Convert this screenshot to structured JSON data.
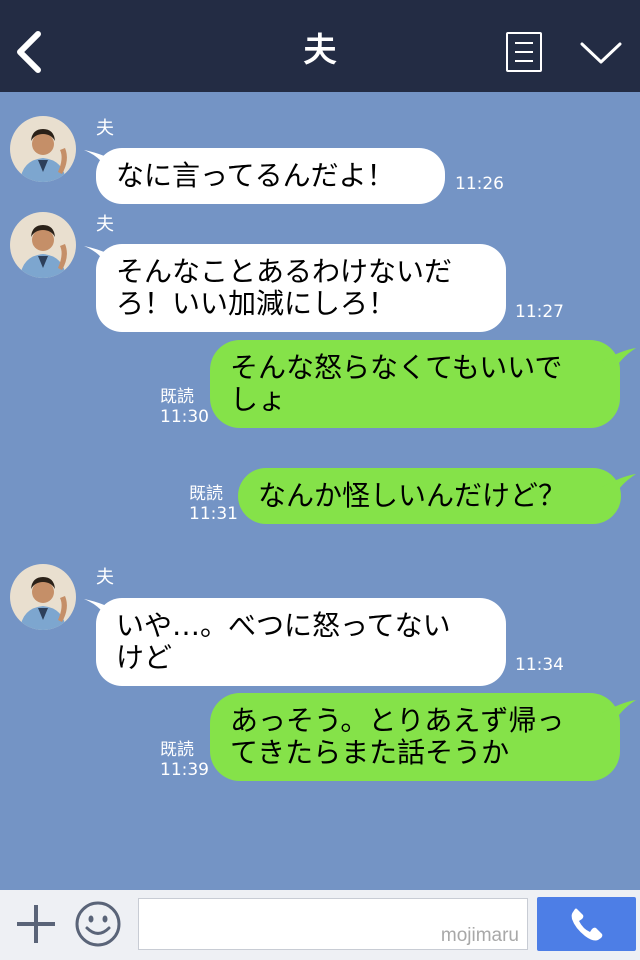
{
  "header": {
    "title": "夫"
  },
  "messages": [
    {
      "side": "in",
      "sender": "夫",
      "text": "なに言ってるんだよ！",
      "time": "11:26"
    },
    {
      "side": "in",
      "sender": "夫",
      "line1": "そんなことあるわけないだ",
      "line2": "ろ！いい加減にしろ！",
      "time": "11:27"
    },
    {
      "side": "out",
      "read": "既読",
      "line1": "そんな怒らなくてもいいで",
      "line2": "しょ",
      "time": "11:30"
    },
    {
      "side": "out",
      "read": "既読",
      "text": "なんか怪しいんだけど？",
      "time": "11:31"
    },
    {
      "side": "in",
      "sender": "夫",
      "line1": "いや…。べつに怒ってない",
      "line2": "けど",
      "time": "11:34"
    },
    {
      "side": "out",
      "read": "既読",
      "line1": "あっそう。とりあえず帰っ",
      "line2": "てきたらまた話そうか",
      "time": "11:39"
    }
  ],
  "input": {
    "value": "",
    "watermark": "mojimaru"
  },
  "icons": {
    "back": "chevron-left-icon",
    "menu": "menu-icon",
    "collapse": "chevron-down-icon",
    "add": "plus-icon",
    "sticker": "smile-icon",
    "call": "phone-icon"
  },
  "colors": {
    "header": "#232c44",
    "background": "#7494c5",
    "incoming": "#ffffff",
    "outgoing": "#85e249",
    "call_button": "#4d7ee6"
  }
}
